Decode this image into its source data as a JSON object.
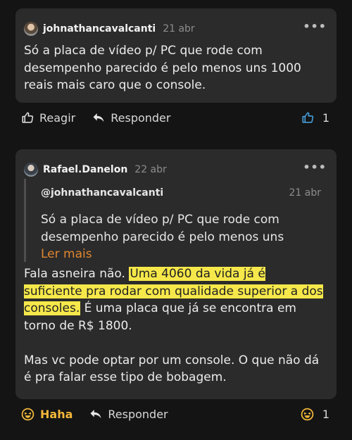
{
  "comment1": {
    "user": "johnathancavalcanti",
    "date": "21 abr",
    "body": "Só a placa de vídeo p/ PC que rode com desempenho parecido é pelo menos uns 1000 reais mais caro que o console.",
    "actions": {
      "react": "Reagir",
      "reply": "Responder",
      "like_count": "1"
    }
  },
  "comment2": {
    "user": "Rafael.Danelon",
    "date": "22 abr",
    "quote": {
      "mention": "@johnathancavalcanti",
      "date": "21 abr",
      "text": "Só a placa de vídeo p/ PC que rode com desempenho parecido é pelo menos uns",
      "read_more": "Ler mais"
    },
    "body_pre": "Fala asneira não. ",
    "body_highlight": "Uma 4060 da vida já é suficiente pra rodar com qualidade superior a dos consoles.",
    "body_post": " É uma placa que já se encontra em torno de R$ 1800.",
    "body_para2": "Mas vc pode optar por um console. O que não dá é pra falar esse tipo de bobagem.",
    "actions": {
      "react": "Haha",
      "reply": "Responder",
      "reaction_count": "1"
    }
  },
  "more_glyph": "•••",
  "colors": {
    "highlight": "#f6e84a",
    "link": "#e0872e",
    "haha": "#f4b83a",
    "like": "#4aa6e6"
  },
  "icons": [
    "more-icon",
    "thumbs-up-icon",
    "reply-arrow-icon",
    "haha-emoji-icon",
    "avatar"
  ]
}
